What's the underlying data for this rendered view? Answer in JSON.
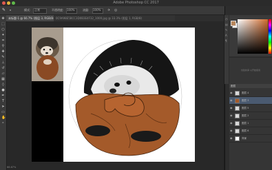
{
  "app": {
    "title": "Adobe Photoshop CC 2017"
  },
  "colors": {
    "accent": "#d06a2c",
    "hedgehog_brown": "#a45a2a",
    "selection_blue": "#4a5a70"
  },
  "options_bar": {
    "tool_icon": "brush-icon",
    "mode_label": "模式:",
    "mode_value": "正常",
    "opacity_label": "不透明度:",
    "opacity_value": "100%",
    "flow_label": "流量:",
    "flow_value": "100%"
  },
  "tabs": [
    {
      "label": "未标题-1 @ 66.7% (图层 3, RGB/8#)",
      "active": true
    },
    {
      "label": "0C9A98E5BCC3D0B3E4F32_1000.jpg @ 33.3% (图层 1, RGB/8)",
      "active": false
    }
  ],
  "tools": [
    "move-icon",
    "marquee-icon",
    "lasso-icon",
    "magic-wand-icon",
    "crop-icon",
    "eyedropper-icon",
    "healing-icon",
    "brush-icon",
    "stamp-icon",
    "history-brush-icon",
    "eraser-icon",
    "gradient-icon",
    "blur-icon",
    "dodge-icon",
    "pen-icon",
    "type-icon",
    "path-select-icon",
    "shape-icon",
    "hand-icon",
    "zoom-icon"
  ],
  "libraries": {
    "message": "创建新库 以开始使用"
  },
  "layers": {
    "header": "图层",
    "items": [
      {
        "name": "图层 4",
        "visible": true,
        "selected": false
      },
      {
        "name": "图层 3",
        "visible": true,
        "selected": true
      },
      {
        "name": "图层 5",
        "visible": true,
        "selected": false
      },
      {
        "name": "图层 2",
        "visible": true,
        "selected": false
      },
      {
        "name": "图层 1",
        "visible": true,
        "selected": false
      },
      {
        "name": "图层 6",
        "visible": true,
        "selected": false
      },
      {
        "name": "背景",
        "visible": true,
        "selected": false
      }
    ]
  },
  "status": {
    "zoom": "66.67%"
  }
}
